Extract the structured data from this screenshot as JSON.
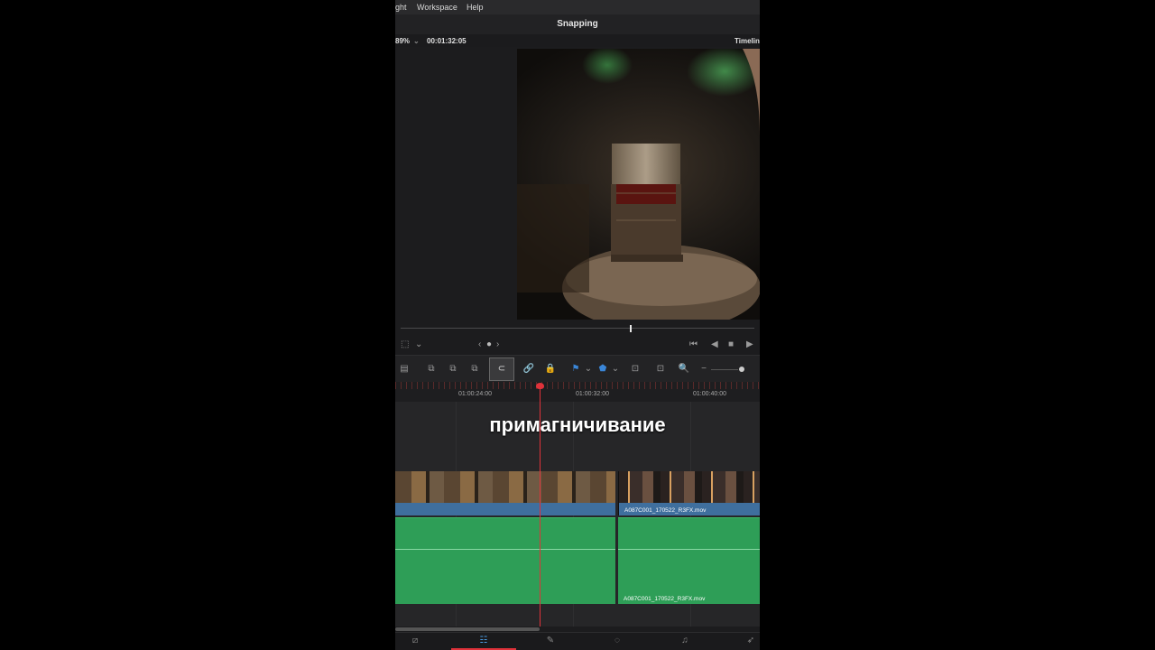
{
  "menubar": {
    "items": [
      "ght",
      "Workspace",
      "Help"
    ]
  },
  "titlebar": {
    "title": "Snapping"
  },
  "infobar": {
    "zoom": "89%",
    "timecode": "00:01:32:05",
    "panel_label": "Timelin"
  },
  "viewer": {
    "description_icon": "crop-icon"
  },
  "ruler": {
    "labels": [
      "01:00:24:00",
      "01:00:32:00",
      "01:00:40:00"
    ],
    "playhead_marker": "5/13\n030"
  },
  "overlay": {
    "caption": "примагничивание"
  },
  "clips": {
    "video_2_name": "A087C001_170522_R3FX.mov",
    "audio_2_name": "A087C001_170522_R3FX.mov"
  },
  "colors": {
    "accent": "#e0323a",
    "video": "#3f6f9e",
    "audio": "#2e9e57"
  }
}
